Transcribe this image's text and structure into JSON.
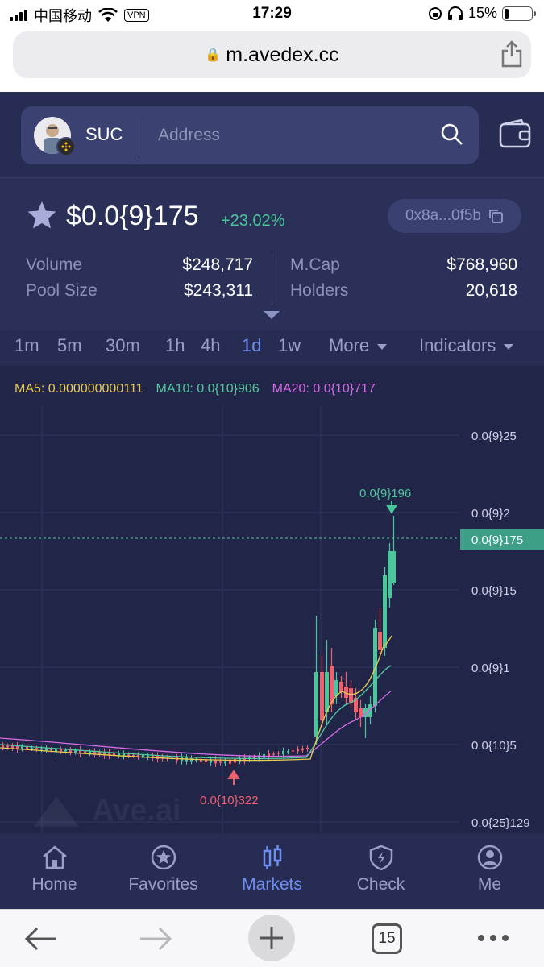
{
  "status_bar": {
    "carrier": "中国移动",
    "vpn": "VPN",
    "time": "17:29",
    "battery": "15%"
  },
  "browser": {
    "url": "m.avedex.cc",
    "tab_count": "15"
  },
  "search": {
    "token_symbol": "SUC",
    "placeholder": "Address"
  },
  "token": {
    "price": "$0.0{9}175",
    "change": "+23.02%",
    "address": "0x8a...0f5b",
    "stats_left": [
      {
        "label": "Volume",
        "value": "$248,717"
      },
      {
        "label": "Pool Size",
        "value": "$243,311"
      }
    ],
    "stats_right": [
      {
        "label": "M.Cap",
        "value": "$768,960"
      },
      {
        "label": "Holders",
        "value": "20,618"
      }
    ]
  },
  "timeframes": [
    "1m",
    "5m",
    "30m",
    "1h",
    "4h",
    "1d",
    "1w"
  ],
  "active_timeframe": "1d",
  "more_label": "More",
  "indicators_label": "Indicators",
  "chart": {
    "ma5": "MA5: 0.000000000111",
    "ma10": "MA10: 0.0{10}906",
    "ma20": "MA20: 0.0{10}717",
    "y_ticks": [
      "0.0{9}25",
      "0.0{9}2",
      "0.0{9}15",
      "0.0{9}1",
      "0.0{10}5",
      "0.0{25}129"
    ],
    "current_price_label": "0.0{9}175",
    "high_label": "0.0{9}196",
    "low_label": "0.0{10}322",
    "watermark": "Ave.ai",
    "colors": {
      "up": "#4cc59d",
      "down": "#f0616d",
      "ma5": "#e8cc52",
      "ma10": "#55c8a0",
      "ma20": "#d46ce6"
    }
  },
  "tabs": [
    {
      "label": "Home",
      "icon": "home-icon"
    },
    {
      "label": "Favorites",
      "icon": "favorites-icon"
    },
    {
      "label": "Markets",
      "icon": "markets-icon"
    },
    {
      "label": "Check",
      "icon": "check-icon"
    },
    {
      "label": "Me",
      "icon": "me-icon"
    }
  ],
  "active_tab": "Markets"
}
